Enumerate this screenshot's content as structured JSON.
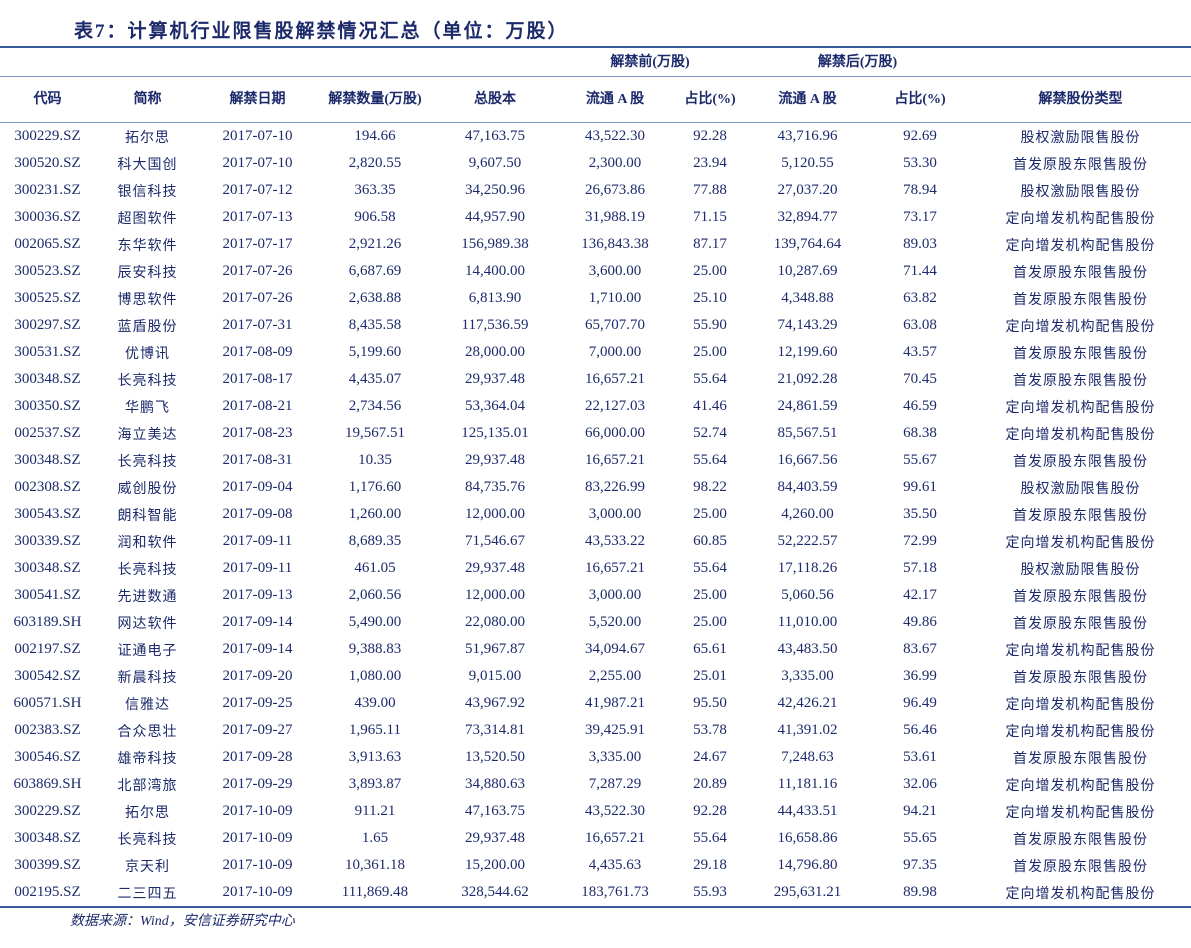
{
  "title": "表7：计算机行业限售股解禁情况汇总（单位：万股）",
  "group_headers": {
    "before": "解禁前(万股)",
    "after": "解禁后(万股)"
  },
  "columns": [
    "代码",
    "简称",
    "解禁日期",
    "解禁数量(万股)",
    "总股本",
    "流通 A 股",
    "占比(%)",
    "流通 A 股",
    "占比(%)",
    "解禁股份类型"
  ],
  "rows": [
    [
      "300229.SZ",
      "拓尔思",
      "2017-07-10",
      "194.66",
      "47,163.75",
      "43,522.30",
      "92.28",
      "43,716.96",
      "92.69",
      "股权激励限售股份"
    ],
    [
      "300520.SZ",
      "科大国创",
      "2017-07-10",
      "2,820.55",
      "9,607.50",
      "2,300.00",
      "23.94",
      "5,120.55",
      "53.30",
      "首发原股东限售股份"
    ],
    [
      "300231.SZ",
      "银信科技",
      "2017-07-12",
      "363.35",
      "34,250.96",
      "26,673.86",
      "77.88",
      "27,037.20",
      "78.94",
      "股权激励限售股份"
    ],
    [
      "300036.SZ",
      "超图软件",
      "2017-07-13",
      "906.58",
      "44,957.90",
      "31,988.19",
      "71.15",
      "32,894.77",
      "73.17",
      "定向增发机构配售股份"
    ],
    [
      "002065.SZ",
      "东华软件",
      "2017-07-17",
      "2,921.26",
      "156,989.38",
      "136,843.38",
      "87.17",
      "139,764.64",
      "89.03",
      "定向增发机构配售股份"
    ],
    [
      "300523.SZ",
      "辰安科技",
      "2017-07-26",
      "6,687.69",
      "14,400.00",
      "3,600.00",
      "25.00",
      "10,287.69",
      "71.44",
      "首发原股东限售股份"
    ],
    [
      "300525.SZ",
      "博思软件",
      "2017-07-26",
      "2,638.88",
      "6,813.90",
      "1,710.00",
      "25.10",
      "4,348.88",
      "63.82",
      "首发原股东限售股份"
    ],
    [
      "300297.SZ",
      "蓝盾股份",
      "2017-07-31",
      "8,435.58",
      "117,536.59",
      "65,707.70",
      "55.90",
      "74,143.29",
      "63.08",
      "定向增发机构配售股份"
    ],
    [
      "300531.SZ",
      "优博讯",
      "2017-08-09",
      "5,199.60",
      "28,000.00",
      "7,000.00",
      "25.00",
      "12,199.60",
      "43.57",
      "首发原股东限售股份"
    ],
    [
      "300348.SZ",
      "长亮科技",
      "2017-08-17",
      "4,435.07",
      "29,937.48",
      "16,657.21",
      "55.64",
      "21,092.28",
      "70.45",
      "首发原股东限售股份"
    ],
    [
      "300350.SZ",
      "华鹏飞",
      "2017-08-21",
      "2,734.56",
      "53,364.04",
      "22,127.03",
      "41.46",
      "24,861.59",
      "46.59",
      "定向增发机构配售股份"
    ],
    [
      "002537.SZ",
      "海立美达",
      "2017-08-23",
      "19,567.51",
      "125,135.01",
      "66,000.00",
      "52.74",
      "85,567.51",
      "68.38",
      "定向增发机构配售股份"
    ],
    [
      "300348.SZ",
      "长亮科技",
      "2017-08-31",
      "10.35",
      "29,937.48",
      "16,657.21",
      "55.64",
      "16,667.56",
      "55.67",
      "首发原股东限售股份"
    ],
    [
      "002308.SZ",
      "威创股份",
      "2017-09-04",
      "1,176.60",
      "84,735.76",
      "83,226.99",
      "98.22",
      "84,403.59",
      "99.61",
      "股权激励限售股份"
    ],
    [
      "300543.SZ",
      "朗科智能",
      "2017-09-08",
      "1,260.00",
      "12,000.00",
      "3,000.00",
      "25.00",
      "4,260.00",
      "35.50",
      "首发原股东限售股份"
    ],
    [
      "300339.SZ",
      "润和软件",
      "2017-09-11",
      "8,689.35",
      "71,546.67",
      "43,533.22",
      "60.85",
      "52,222.57",
      "72.99",
      "定向增发机构配售股份"
    ],
    [
      "300348.SZ",
      "长亮科技",
      "2017-09-11",
      "461.05",
      "29,937.48",
      "16,657.21",
      "55.64",
      "17,118.26",
      "57.18",
      "股权激励限售股份"
    ],
    [
      "300541.SZ",
      "先进数通",
      "2017-09-13",
      "2,060.56",
      "12,000.00",
      "3,000.00",
      "25.00",
      "5,060.56",
      "42.17",
      "首发原股东限售股份"
    ],
    [
      "603189.SH",
      "网达软件",
      "2017-09-14",
      "5,490.00",
      "22,080.00",
      "5,520.00",
      "25.00",
      "11,010.00",
      "49.86",
      "首发原股东限售股份"
    ],
    [
      "002197.SZ",
      "证通电子",
      "2017-09-14",
      "9,388.83",
      "51,967.87",
      "34,094.67",
      "65.61",
      "43,483.50",
      "83.67",
      "定向增发机构配售股份"
    ],
    [
      "300542.SZ",
      "新晨科技",
      "2017-09-20",
      "1,080.00",
      "9,015.00",
      "2,255.00",
      "25.01",
      "3,335.00",
      "36.99",
      "首发原股东限售股份"
    ],
    [
      "600571.SH",
      "信雅达",
      "2017-09-25",
      "439.00",
      "43,967.92",
      "41,987.21",
      "95.50",
      "42,426.21",
      "96.49",
      "定向增发机构配售股份"
    ],
    [
      "002383.SZ",
      "合众思壮",
      "2017-09-27",
      "1,965.11",
      "73,314.81",
      "39,425.91",
      "53.78",
      "41,391.02",
      "56.46",
      "定向增发机构配售股份"
    ],
    [
      "300546.SZ",
      "雄帝科技",
      "2017-09-28",
      "3,913.63",
      "13,520.50",
      "3,335.00",
      "24.67",
      "7,248.63",
      "53.61",
      "首发原股东限售股份"
    ],
    [
      "603869.SH",
      "北部湾旅",
      "2017-09-29",
      "3,893.87",
      "34,880.63",
      "7,287.29",
      "20.89",
      "11,181.16",
      "32.06",
      "定向增发机构配售股份"
    ],
    [
      "300229.SZ",
      "拓尔思",
      "2017-10-09",
      "911.21",
      "47,163.75",
      "43,522.30",
      "92.28",
      "44,433.51",
      "94.21",
      "定向增发机构配售股份"
    ],
    [
      "300348.SZ",
      "长亮科技",
      "2017-10-09",
      "1.65",
      "29,937.48",
      "16,657.21",
      "55.64",
      "16,658.86",
      "55.65",
      "首发原股东限售股份"
    ],
    [
      "300399.SZ",
      "京天利",
      "2017-10-09",
      "10,361.18",
      "15,200.00",
      "4,435.63",
      "29.18",
      "14,796.80",
      "97.35",
      "首发原股东限售股份"
    ],
    [
      "002195.SZ",
      "二三四五",
      "2017-10-09",
      "111,869.48",
      "328,544.62",
      "183,761.73",
      "55.93",
      "295,631.21",
      "89.98",
      "定向增发机构配售股份"
    ]
  ],
  "source": "数据来源：Wind，安信证券研究中心"
}
